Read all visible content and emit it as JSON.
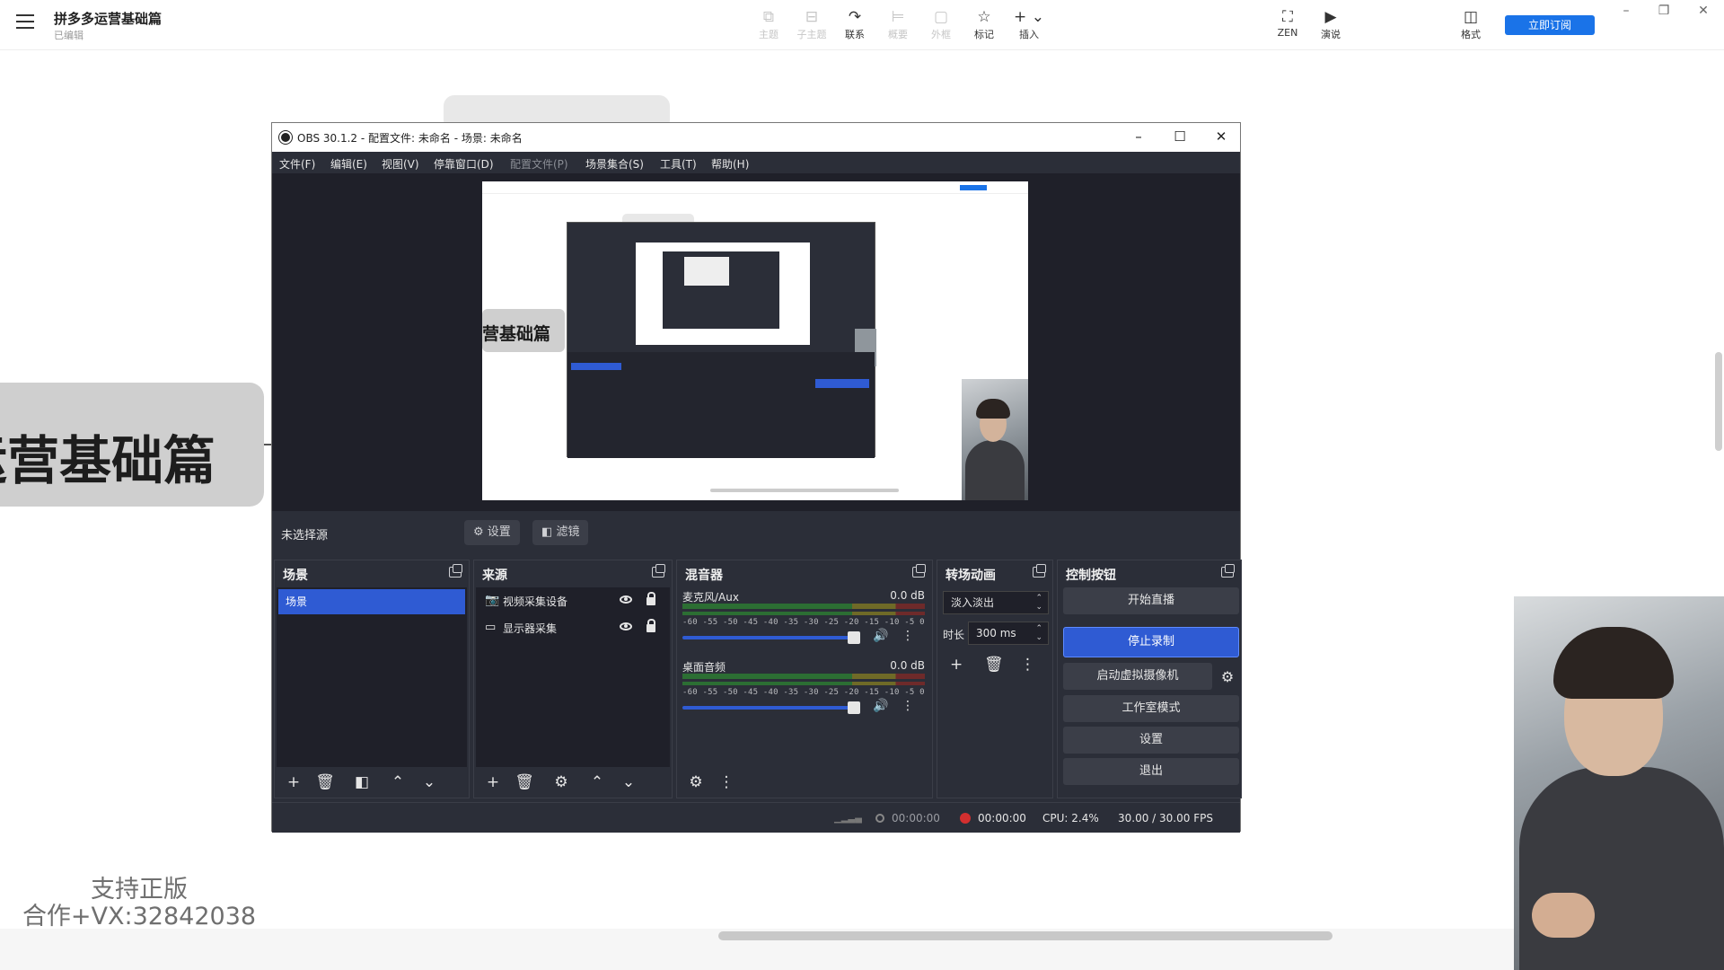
{
  "app": {
    "doc_title": "拼多多运营基础篇",
    "doc_status": "已编辑",
    "toolbar": [
      {
        "label": "主题",
        "icon": "theme-icon",
        "enabled": false
      },
      {
        "label": "子主题",
        "icon": "subtopic-icon",
        "enabled": false
      },
      {
        "label": "联系",
        "icon": "relation-icon",
        "enabled": true
      },
      {
        "label": "概要",
        "icon": "summary-icon",
        "enabled": false
      },
      {
        "label": "外框",
        "icon": "boundary-icon",
        "enabled": false
      },
      {
        "label": "标记",
        "icon": "star-icon",
        "enabled": true
      },
      {
        "label": "插入",
        "icon": "plus-icon",
        "enabled": true
      }
    ],
    "zen_label": "ZEN",
    "present_label": "演说",
    "format_label": "格式",
    "subscribe_label": "立即订阅"
  },
  "mindmap": {
    "central_node_text": "运营基础篇",
    "watermark_line1": "支持正版",
    "watermark_line2": "合作+VX:32842038"
  },
  "obs": {
    "window_title": "OBS 30.1.2 - 配置文件: 未命名 - 场景: 未命名",
    "menus": [
      {
        "label": "文件(F)",
        "enabled": true
      },
      {
        "label": "编辑(E)",
        "enabled": true
      },
      {
        "label": "视图(V)",
        "enabled": true
      },
      {
        "label": "停靠窗口(D)",
        "enabled": true
      },
      {
        "label": "配置文件(P)",
        "enabled": false
      },
      {
        "label": "场景集合(S)",
        "enabled": true
      },
      {
        "label": "工具(T)",
        "enabled": true
      },
      {
        "label": "帮助(H)",
        "enabled": true
      }
    ],
    "preview_node_text": "营基础篇",
    "no_source_label": "未选择源",
    "properties_label": "设置",
    "filters_label": "滤镜",
    "docks": {
      "scenes": {
        "title": "场景",
        "items": [
          "场景"
        ]
      },
      "sources": {
        "title": "来源",
        "items": [
          {
            "label": "视频采集设备",
            "icon": "camera-icon"
          },
          {
            "label": "显示器采集",
            "icon": "monitor-icon"
          }
        ]
      },
      "mixer": {
        "title": "混音器",
        "channels": [
          {
            "name": "麦克风/Aux",
            "db": "0.0 dB",
            "level": 1.0
          },
          {
            "name": "桌面音频",
            "db": "0.0 dB",
            "level": 1.0
          }
        ],
        "ticks": "-60 -55 -50 -45 -40 -35 -30 -25 -20 -15 -10 -5 0"
      },
      "transitions": {
        "title": "转场动画",
        "selected": "淡入淡出",
        "duration_label": "时长",
        "duration_value": "300 ms"
      },
      "controls": {
        "title": "控制按钮",
        "start_stream": "开始直播",
        "stop_record": "停止录制",
        "start_virtual_cam": "启动虚拟摄像机",
        "studio_mode": "工作室模式",
        "settings": "设置",
        "exit": "退出"
      }
    },
    "status": {
      "stream_time": "00:00:00",
      "record_time": "00:00:00",
      "cpu": "CPU: 2.4%",
      "fps": "30.00 / 30.00 FPS"
    }
  },
  "colors": {
    "accent": "#2f5bd3",
    "brand_button": "#1a73e8",
    "recording": "#d32f2f"
  }
}
